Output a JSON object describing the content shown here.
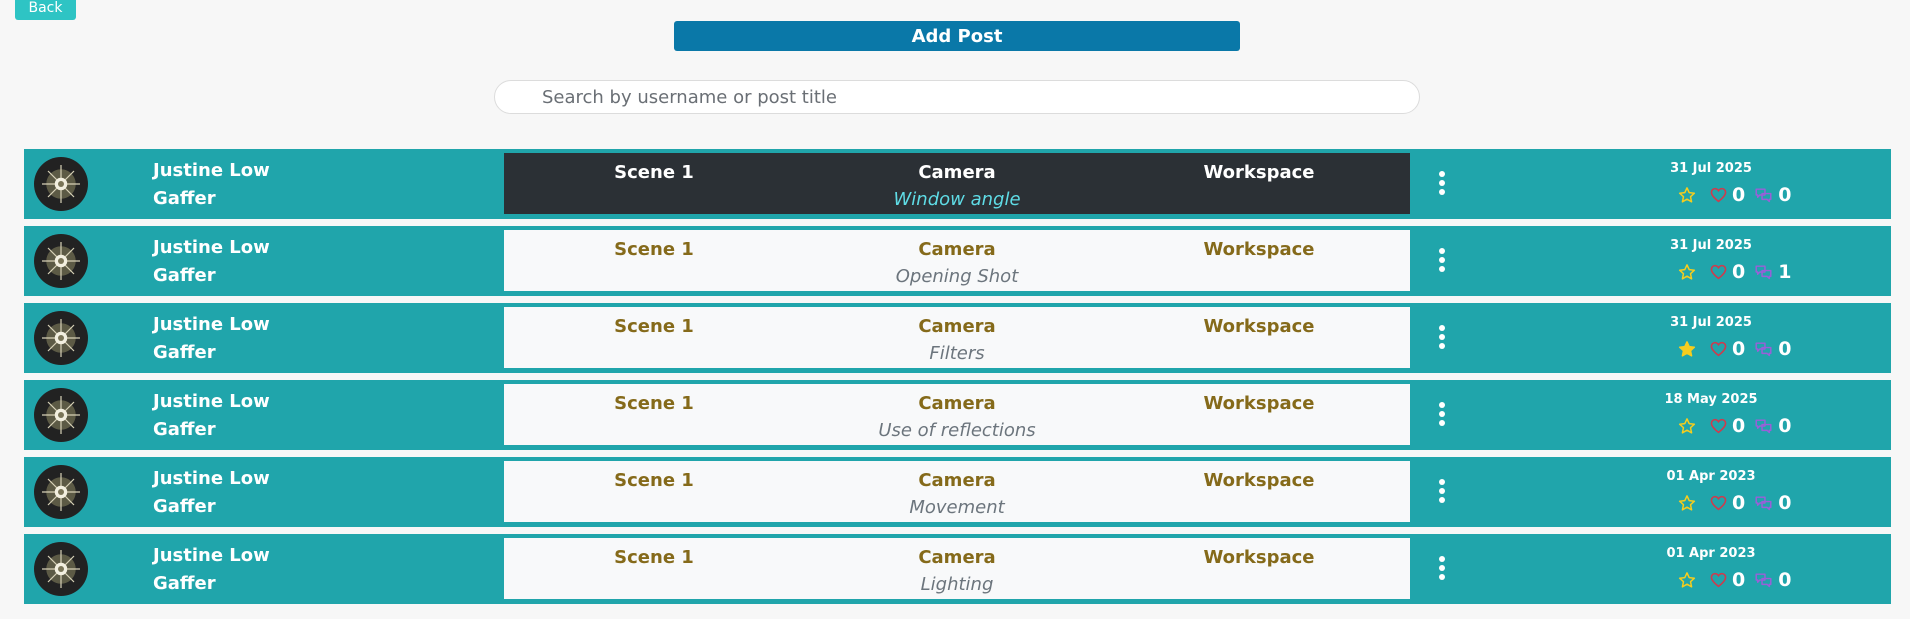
{
  "header": {
    "back_label": "Back",
    "add_post_label": "Add Post"
  },
  "search": {
    "placeholder": "Search by username or post title",
    "value": ""
  },
  "colors": {
    "row_bg": "#20a5ab",
    "add_post_bg": "#0a78a8",
    "back_bg": "#2ec4c4",
    "meta_text": "#856a1a",
    "selected_card_bg": "#2b3035",
    "selected_title": "#5fdce6"
  },
  "icons": [
    "star-icon",
    "heart-icon",
    "comment-icon",
    "kebab-menu-icon",
    "avatar-image"
  ],
  "posts": [
    {
      "user_name": "Justine Low",
      "role": "Gaffer",
      "scene": "Scene 1",
      "department": "Camera",
      "location": "Workspace",
      "title": "Window angle",
      "date": "31 Jul 2025",
      "likes": "0",
      "comments": "0",
      "starred": false,
      "selected": true
    },
    {
      "user_name": "Justine Low",
      "role": "Gaffer",
      "scene": "Scene 1",
      "department": "Camera",
      "location": "Workspace",
      "title": "Opening Shot",
      "date": "31 Jul 2025",
      "likes": "0",
      "comments": "1",
      "starred": false,
      "selected": false
    },
    {
      "user_name": "Justine Low",
      "role": "Gaffer",
      "scene": "Scene 1",
      "department": "Camera",
      "location": "Workspace",
      "title": "Filters",
      "date": "31 Jul 2025",
      "likes": "0",
      "comments": "0",
      "starred": true,
      "selected": false
    },
    {
      "user_name": "Justine Low",
      "role": "Gaffer",
      "scene": "Scene 1",
      "department": "Camera",
      "location": "Workspace",
      "title": "Use of reflections",
      "date": "18 May 2025",
      "likes": "0",
      "comments": "0",
      "starred": false,
      "selected": false
    },
    {
      "user_name": "Justine Low",
      "role": "Gaffer",
      "scene": "Scene 1",
      "department": "Camera",
      "location": "Workspace",
      "title": "Movement",
      "date": "01 Apr 2023",
      "likes": "0",
      "comments": "0",
      "starred": false,
      "selected": false
    },
    {
      "user_name": "Justine Low",
      "role": "Gaffer",
      "scene": "Scene 1",
      "department": "Camera",
      "location": "Workspace",
      "title": "Lighting",
      "date": "01 Apr 2023",
      "likes": "0",
      "comments": "0",
      "starred": false,
      "selected": false
    }
  ]
}
